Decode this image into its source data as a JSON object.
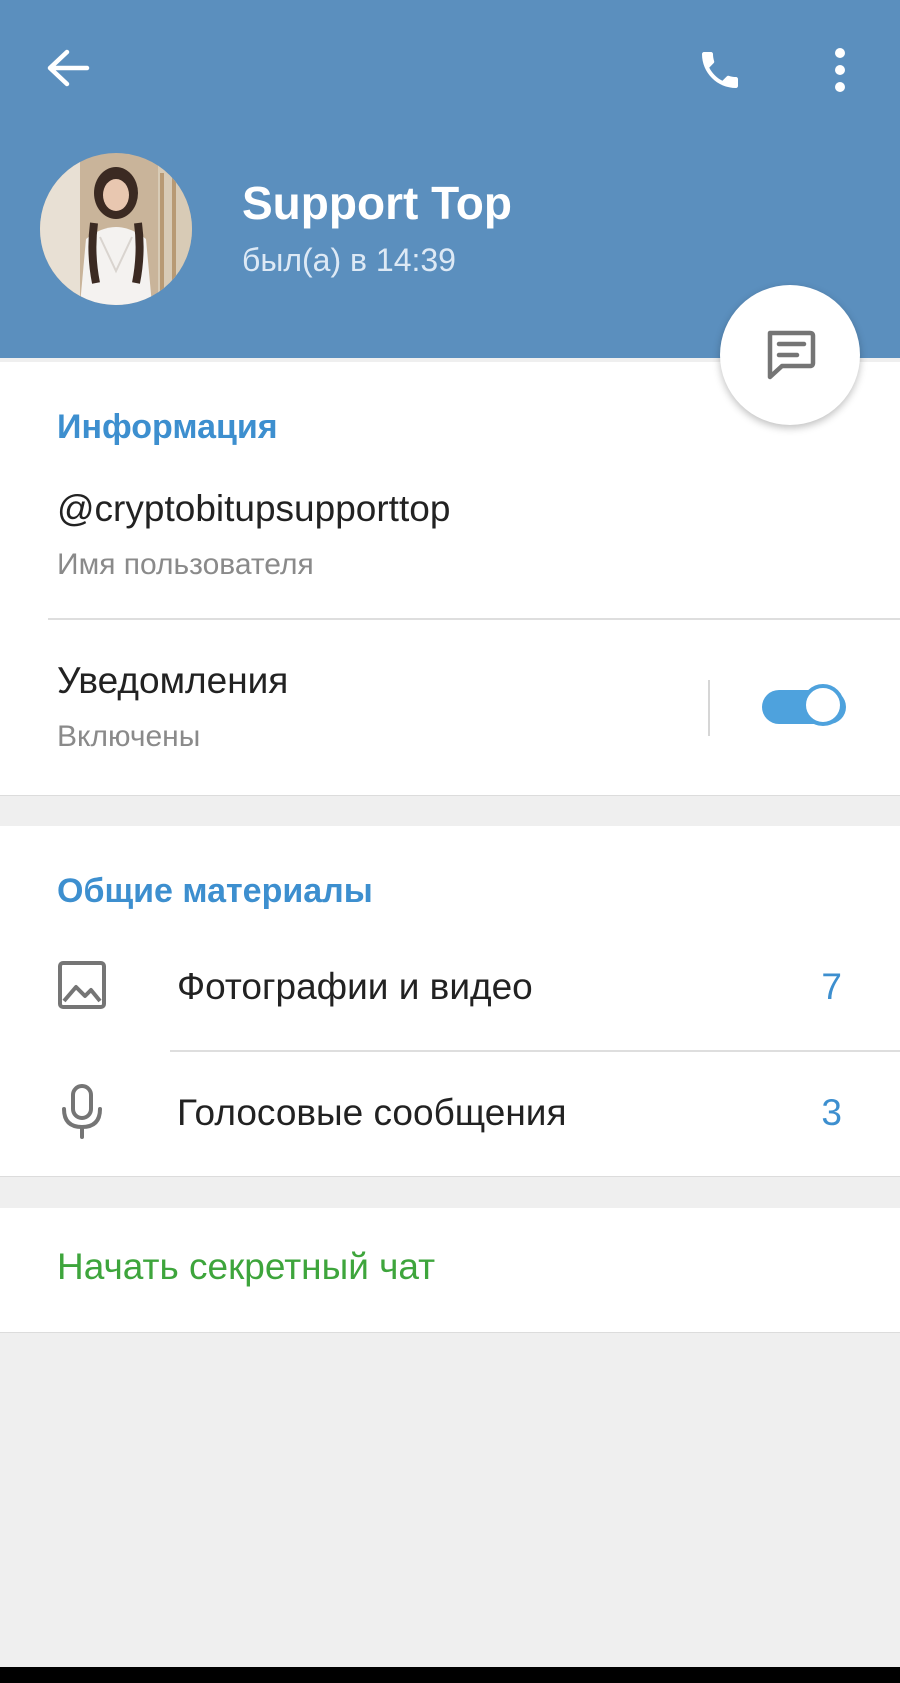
{
  "header": {
    "name": "Support Top",
    "status": "был(а) в 14:39",
    "back_icon": "arrow-back-icon",
    "call_icon": "phone-icon",
    "menu_icon": "more-vertical-icon",
    "background_color": "#5b8fbe"
  },
  "fab": {
    "icon": "message-icon"
  },
  "info": {
    "title": "Информация",
    "username": "@cryptobitupsupporttop",
    "username_caption": "Имя пользователя",
    "notifications_label": "Уведомления",
    "notifications_status": "Включены",
    "notifications_enabled": true
  },
  "shared": {
    "title": "Общие материалы",
    "items": [
      {
        "icon": "image-icon",
        "label": "Фотографии и видео",
        "count": "7"
      },
      {
        "icon": "microphone-icon",
        "label": "Голосовые сообщения",
        "count": "3"
      }
    ]
  },
  "secret_chat": {
    "label": "Начать секретный чат"
  },
  "colors": {
    "accent": "#3d8fcf",
    "secret": "#3ea53c",
    "toggle": "#4ea2dd"
  }
}
